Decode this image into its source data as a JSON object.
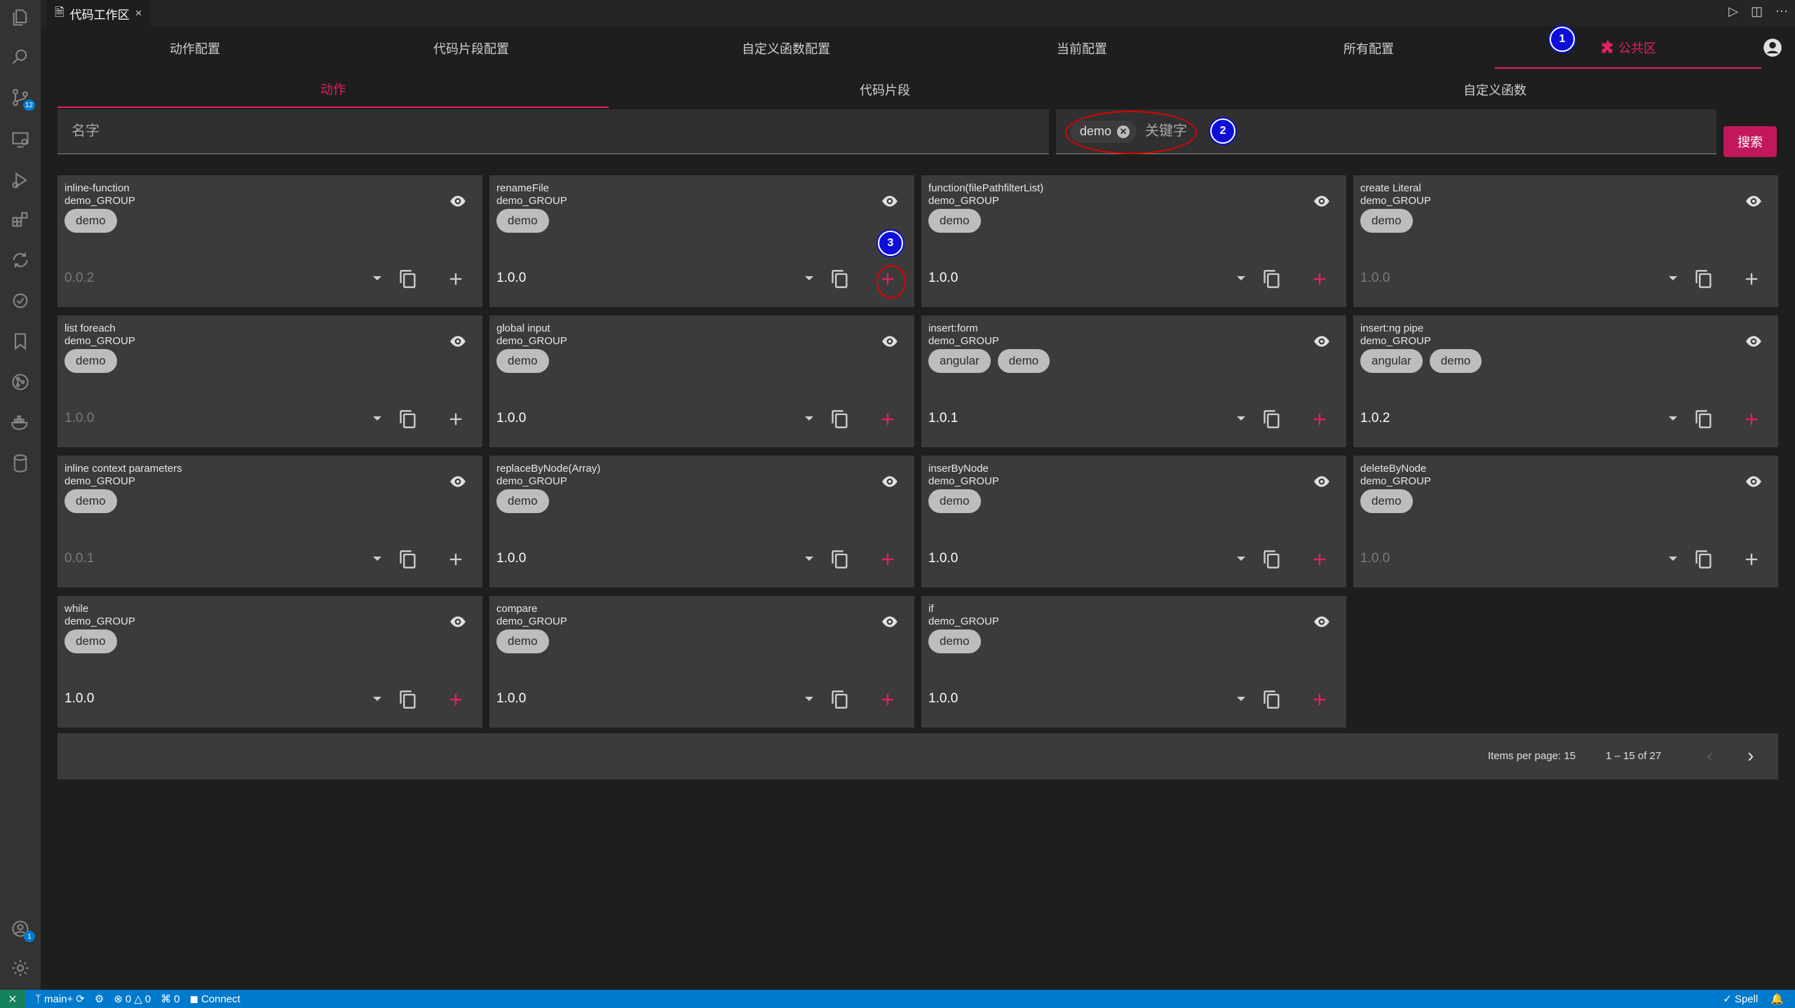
{
  "tab": {
    "title": "代码工作区",
    "close": "×"
  },
  "nav": [
    {
      "label": "动作配置"
    },
    {
      "label": "代码片段配置"
    },
    {
      "label": "自定义函数配置"
    },
    {
      "label": "当前配置"
    },
    {
      "label": "所有配置"
    },
    {
      "label": "公共区",
      "active": true
    }
  ],
  "subtabs": [
    {
      "label": "动作",
      "active": true
    },
    {
      "label": "代码片段"
    },
    {
      "label": "自定义函数"
    }
  ],
  "search": {
    "name_placeholder": "名字",
    "keyword_chip": "demo",
    "keyword_placeholder": "关键字",
    "button": "搜索"
  },
  "annotations": [
    "1",
    "2",
    "3"
  ],
  "cards": [
    {
      "title": "inline-function",
      "group": "demo_GROUP",
      "tags": [
        "demo"
      ],
      "version": "0.0.2",
      "dim": true
    },
    {
      "title": "renameFile",
      "group": "demo_GROUP",
      "tags": [
        "demo"
      ],
      "version": "1.0.0",
      "dim": false
    },
    {
      "title": "function(filePathfilterList)",
      "group": "demo_GROUP",
      "tags": [
        "demo"
      ],
      "version": "1.0.0",
      "dim": false
    },
    {
      "title": "create Literal",
      "group": "demo_GROUP",
      "tags": [
        "demo"
      ],
      "version": "1.0.0",
      "dim": true
    },
    {
      "title": "list foreach",
      "group": "demo_GROUP",
      "tags": [
        "demo"
      ],
      "version": "1.0.0",
      "dim": true
    },
    {
      "title": "global input",
      "group": "demo_GROUP",
      "tags": [
        "demo"
      ],
      "version": "1.0.0",
      "dim": false
    },
    {
      "title": "insert:form",
      "group": "demo_GROUP",
      "tags": [
        "angular",
        "demo"
      ],
      "version": "1.0.1",
      "dim": false
    },
    {
      "title": "insert:ng pipe",
      "group": "demo_GROUP",
      "tags": [
        "angular",
        "demo"
      ],
      "version": "1.0.2",
      "dim": false
    },
    {
      "title": "inline context parameters",
      "group": "demo_GROUP",
      "tags": [
        "demo"
      ],
      "version": "0.0.1",
      "dim": true
    },
    {
      "title": "replaceByNode(Array)",
      "group": "demo_GROUP",
      "tags": [
        "demo"
      ],
      "version": "1.0.0",
      "dim": false
    },
    {
      "title": "inserByNode",
      "group": "demo_GROUP",
      "tags": [
        "demo"
      ],
      "version": "1.0.0",
      "dim": false
    },
    {
      "title": "deleteByNode",
      "group": "demo_GROUP",
      "tags": [
        "demo"
      ],
      "version": "1.0.0",
      "dim": true
    },
    {
      "title": "while",
      "group": "demo_GROUP",
      "tags": [
        "demo"
      ],
      "version": "1.0.0",
      "dim": false
    },
    {
      "title": "compare",
      "group": "demo_GROUP",
      "tags": [
        "demo"
      ],
      "version": "1.0.0",
      "dim": false
    },
    {
      "title": "if",
      "group": "demo_GROUP",
      "tags": [
        "demo"
      ],
      "version": "1.0.0",
      "dim": false
    }
  ],
  "paginator": {
    "items_per_page": "Items per page: 15",
    "range": "1 – 15 of 27"
  },
  "activity_badges": {
    "source_control": "12",
    "accounts": "1"
  },
  "status": {
    "branch": "main+",
    "problems": "0",
    "warnings": "0",
    "ports": "0",
    "connect": "Connect",
    "spell": "Spell"
  },
  "colors": {
    "accent": "#e91e63",
    "status": "#007acc",
    "card": "#3b3b3b"
  }
}
